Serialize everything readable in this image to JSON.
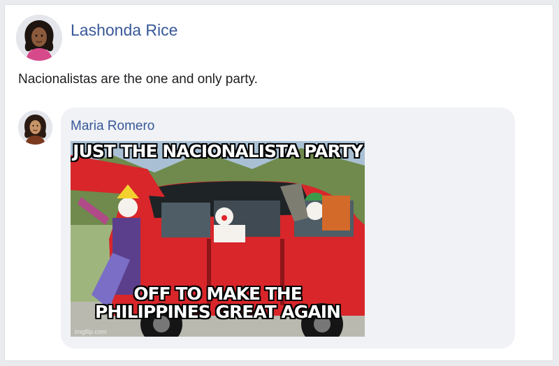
{
  "post": {
    "author_name": "Lashonda Rice",
    "text": "Nacionalistas are the one and only party."
  },
  "comment": {
    "author_name": "Maria Romero",
    "meme": {
      "top_caption": "JUST THE NACIONALISTA PARTY",
      "bottom_caption_line1": "OFF TO MAKE THE",
      "bottom_caption_line2": "PHILIPPINES GREAT AGAIN",
      "watermark": "imgflip.com"
    }
  },
  "colors": {
    "name_link": "#385898",
    "bubble": "#f0f2f5",
    "car_red": "#d8262a"
  }
}
